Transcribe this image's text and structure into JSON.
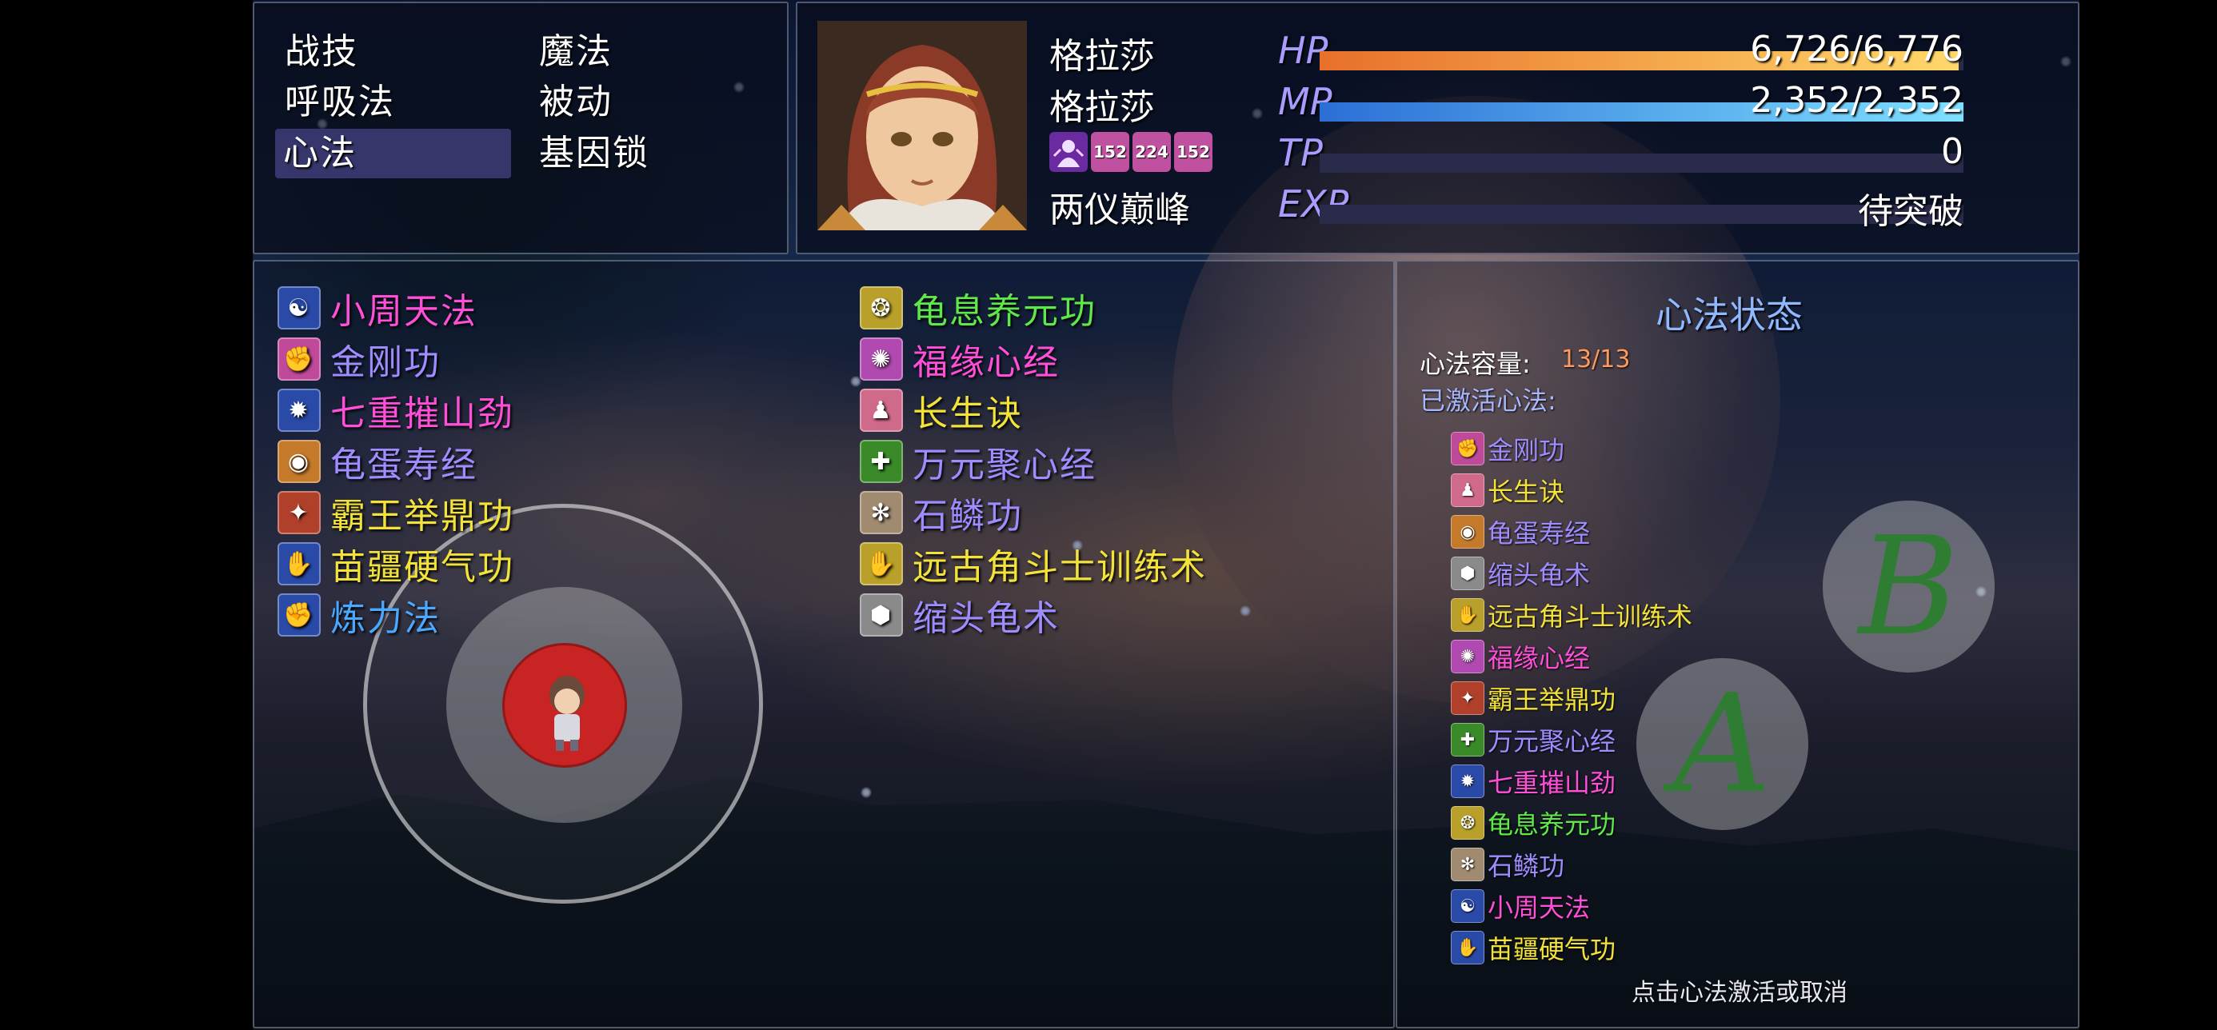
{
  "categories": [
    {
      "label": "战技"
    },
    {
      "label": "魔法"
    },
    {
      "label": "呼吸法"
    },
    {
      "label": "被动"
    },
    {
      "label": "心法",
      "selected": true
    },
    {
      "label": "基因锁"
    }
  ],
  "actor": {
    "name": "格拉莎",
    "nickname": "格拉莎",
    "title": "两仪巅峰",
    "state_icons": [
      {
        "icon": "purple-aura-icon",
        "turns": ""
      },
      {
        "icon": "pink-buff-icon",
        "turns": "152"
      },
      {
        "icon": "pink-buff-icon",
        "turns": "224"
      },
      {
        "icon": "pink-buff-icon",
        "turns": "152"
      }
    ]
  },
  "gauges": {
    "hp": {
      "label": "HP",
      "value_text": "6,726/6,776",
      "current": 6726,
      "max": 6776,
      "color_from": "#e8702a",
      "color_to": "#ffd86a"
    },
    "mp": {
      "label": "MP",
      "value_text": "2,352/2,352",
      "current": 2352,
      "max": 2352,
      "color_from": "#2b6fd6",
      "color_to": "#7fe0ff"
    },
    "tp": {
      "label": "TP",
      "value_text": "0",
      "current": 0,
      "max": 100
    },
    "exp": {
      "label": "EXP",
      "value_text": "待突破",
      "current": 0,
      "max": 100
    }
  },
  "skills_left": [
    {
      "name": "小周天法",
      "color": "#ff4fd8",
      "icon": "meditation-icon",
      "icon_bg": "#2a4aa8"
    },
    {
      "name": "金刚功",
      "color": "#9f8cff",
      "icon": "muscle-icon",
      "icon_bg": "#c04a9a"
    },
    {
      "name": "七重摧山劲",
      "color": "#ff4fd8",
      "icon": "burst-icon",
      "icon_bg": "#2a4aa8"
    },
    {
      "name": "龟蛋寿经",
      "color": "#9f8cff",
      "icon": "egg-icon",
      "icon_bg": "#c47a2a"
    },
    {
      "name": "霸王举鼎功",
      "color": "#f2e23a",
      "icon": "strength-arm-icon",
      "icon_bg": "#b0402a"
    },
    {
      "name": "苗疆硬气功",
      "color": "#f2e23a",
      "icon": "palm-icon",
      "icon_bg": "#2a4aa8"
    },
    {
      "name": "炼力法",
      "color": "#4aa8ff",
      "icon": "fist-icon",
      "icon_bg": "#2a4aa8"
    }
  ],
  "skills_right": [
    {
      "name": "龟息养元功",
      "color": "#5fe84a",
      "icon": "triple-orb-icon",
      "icon_bg": "#b8a02a"
    },
    {
      "name": "福缘心经",
      "color": "#ff4fd8",
      "icon": "gear-charm-icon",
      "icon_bg": "#b04ab0"
    },
    {
      "name": "长生诀",
      "color": "#f2e23a",
      "icon": "body-icon",
      "icon_bg": "#d06a8a"
    },
    {
      "name": "万元聚心经",
      "color": "#9f8cff",
      "icon": "cross-icon",
      "icon_bg": "#3a8a2a"
    },
    {
      "name": "石鳞功",
      "color": "#9f8cff",
      "icon": "scale-icon",
      "icon_bg": "#a08a70"
    },
    {
      "name": "远古角斗士训练术",
      "color": "#f2e23a",
      "icon": "gauntlet-icon",
      "icon_bg": "#b8a02a"
    },
    {
      "name": "缩头龟术",
      "color": "#9f8cff",
      "icon": "shell-icon",
      "icon_bg": "#8a8a8a"
    }
  ],
  "state_panel": {
    "title": "心法状态",
    "capacity_label": "心法容量:",
    "capacity_value": "13/13",
    "active_label": "已激活心法:",
    "active": [
      {
        "name": "金刚功",
        "color": "#9f8cff",
        "icon": "muscle-icon",
        "icon_bg": "#c04a9a"
      },
      {
        "name": "长生诀",
        "color": "#f2e23a",
        "icon": "body-icon",
        "icon_bg": "#d06a8a"
      },
      {
        "name": "龟蛋寿经",
        "color": "#9f8cff",
        "icon": "egg-icon",
        "icon_bg": "#c47a2a"
      },
      {
        "name": "缩头龟术",
        "color": "#9f8cff",
        "icon": "shell-icon",
        "icon_bg": "#8a8a8a"
      },
      {
        "name": "远古角斗士训练术",
        "color": "#f2e23a",
        "icon": "gauntlet-icon",
        "icon_bg": "#b8a02a"
      },
      {
        "name": "福缘心经",
        "color": "#ff4fd8",
        "icon": "gear-charm-icon",
        "icon_bg": "#b04ab0"
      },
      {
        "name": "霸王举鼎功",
        "color": "#f2e23a",
        "icon": "strength-arm-icon",
        "icon_bg": "#b0402a"
      },
      {
        "name": "万元聚心经",
        "color": "#9f8cff",
        "icon": "cross-icon",
        "icon_bg": "#3a8a2a"
      },
      {
        "name": "七重摧山劲",
        "color": "#ff4fd8",
        "icon": "burst-icon",
        "icon_bg": "#2a4aa8"
      },
      {
        "name": "龟息养元功",
        "color": "#5fe84a",
        "icon": "triple-orb-icon",
        "icon_bg": "#b8a02a"
      },
      {
        "name": "石鳞功",
        "color": "#9f8cff",
        "icon": "scale-icon",
        "icon_bg": "#a08a70"
      },
      {
        "name": "小周天法",
        "color": "#ff4fd8",
        "icon": "meditation-icon",
        "icon_bg": "#2a4aa8"
      },
      {
        "name": "苗疆硬气功",
        "color": "#f2e23a",
        "icon": "palm-icon",
        "icon_bg": "#2a4aa8"
      }
    ],
    "hint": "点击心法激活或取消"
  },
  "controls": {
    "button_a": "A",
    "button_b": "B"
  },
  "colors": {
    "window_bg": "#080c1c",
    "gauge_label": "#a89cff",
    "capacity_value": "#ff9a5c"
  }
}
